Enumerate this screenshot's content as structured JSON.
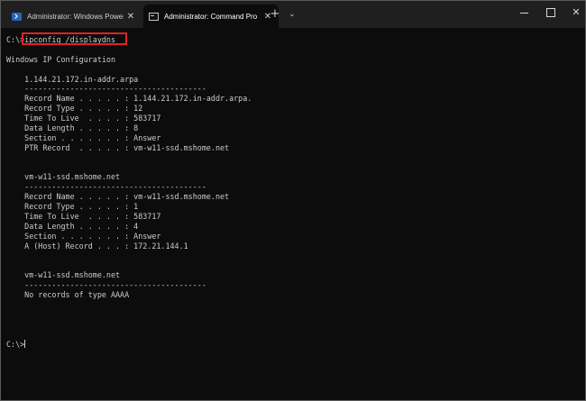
{
  "window": {
    "tabs": [
      {
        "label": "Administrator: Windows Power",
        "icon": "powershell-icon",
        "active": false
      },
      {
        "label": "Administrator: Command Pro",
        "icon": "cmd-icon",
        "active": true
      }
    ],
    "new_tab_label": "+",
    "dropdown_label": "⌄",
    "close_glyph": "✕"
  },
  "terminal": {
    "prompt": "C:\\>",
    "command": "ipconfig /displaydns",
    "output_lines": [
      "",
      "Windows IP Configuration",
      "",
      "    1.144.21.172.in-addr.arpa",
      "    ----------------------------------------",
      "    Record Name . . . . . : 1.144.21.172.in-addr.arpa.",
      "    Record Type . . . . . : 12",
      "    Time To Live  . . . . : 583717",
      "    Data Length . . . . . : 8",
      "    Section . . . . . . . : Answer",
      "    PTR Record  . . . . . : vm-w11-ssd.mshome.net",
      "",
      "",
      "    vm-w11-ssd.mshome.net",
      "    ----------------------------------------",
      "    Record Name . . . . . : vm-w11-ssd.mshome.net",
      "    Record Type . . . . . : 1",
      "    Time To Live  . . . . : 583717",
      "    Data Length . . . . . : 4",
      "    Section . . . . . . . : Answer",
      "    A (Host) Record . . . : 172.21.144.1",
      "",
      "",
      "    vm-w11-ssd.mshome.net",
      "    ----------------------------------------",
      "    No records of type AAAA",
      "",
      "",
      "",
      ""
    ],
    "final_prompt": "C:\\>"
  },
  "colors": {
    "terminal_bg": "#0c0c0c",
    "terminal_fg": "#cccccc",
    "highlight": "#e0222a"
  }
}
